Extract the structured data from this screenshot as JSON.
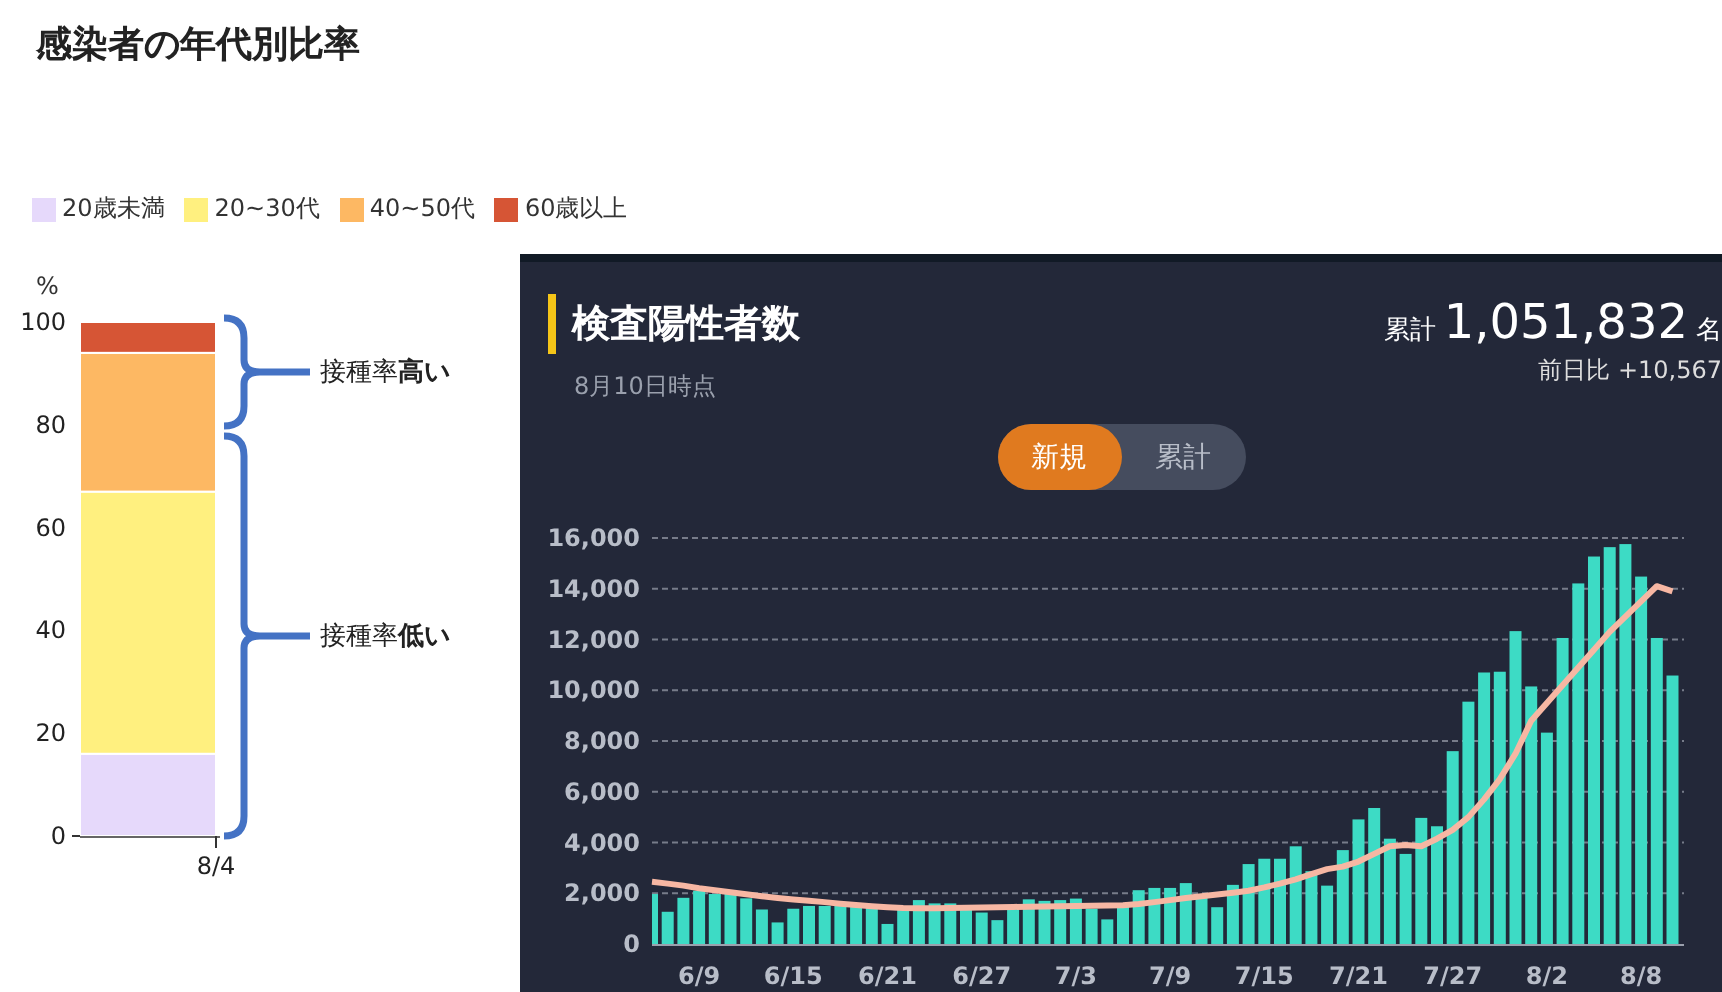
{
  "title": "感染者の年代別比率",
  "age_chart": {
    "chart_data": {
      "type": "bar",
      "stacked": true,
      "ylabel": "%",
      "categories": [
        "8/4"
      ],
      "ylim": [
        0,
        100
      ],
      "yticks": [
        {
          "value": 0,
          "label": "0"
        },
        {
          "value": 20,
          "label": "20"
        },
        {
          "value": 40,
          "label": "40"
        },
        {
          "value": 60,
          "label": "60"
        },
        {
          "value": 80,
          "label": "80"
        },
        {
          "value": 100,
          "label": "100"
        }
      ],
      "series": [
        {
          "name": "20歳未満",
          "color": "#e6d9fb",
          "values": [
            16
          ]
        },
        {
          "name": "20~30代",
          "color": "#fff07f",
          "values": [
            51
          ]
        },
        {
          "name": "40~50代",
          "color": "#fdb863",
          "values": [
            27
          ]
        },
        {
          "name": "60歳以上",
          "color": "#d65535",
          "values": [
            6
          ]
        }
      ],
      "annotations": [
        "接種率**高い**",
        "接種率**低い**"
      ]
    }
  },
  "panel": {
    "title": "検査陽性者数",
    "as_of": "8月10日時点",
    "total_label": "累計",
    "total": "1,051,832",
    "total_unit": "名",
    "change": "前日比 +10,567",
    "toggle": [
      {
        "label": "新規",
        "selected": true
      },
      {
        "label": "累計",
        "selected": false
      }
    ],
    "chart_data": {
      "type": "bar",
      "grid": true,
      "ylim": [
        0,
        16000
      ],
      "yticks": [
        {
          "value": 0,
          "label": "0"
        },
        {
          "value": 2000,
          "label": "2,000"
        },
        {
          "value": 4000,
          "label": "4,000"
        },
        {
          "value": 6000,
          "label": "6,000"
        },
        {
          "value": 8000,
          "label": "8,000"
        },
        {
          "value": 10000,
          "label": "10,000"
        },
        {
          "value": 12000,
          "label": "12,000"
        },
        {
          "value": 14000,
          "label": "14,000"
        },
        {
          "value": 16000,
          "label": "16,000"
        }
      ],
      "categories": [
        null,
        null,
        null,
        "6/9",
        null,
        null,
        null,
        null,
        null,
        "6/15",
        null,
        null,
        null,
        null,
        null,
        "6/21",
        null,
        null,
        null,
        null,
        null,
        "6/27",
        null,
        null,
        null,
        null,
        null,
        "7/3",
        null,
        null,
        null,
        null,
        null,
        "7/9",
        null,
        null,
        null,
        null,
        null,
        "7/15",
        null,
        null,
        null,
        null,
        null,
        "7/21",
        null,
        null,
        null,
        null,
        null,
        "7/27",
        null,
        null,
        null,
        null,
        null,
        "8/2",
        null,
        null,
        null,
        null,
        null,
        "8/8",
        null,
        null
      ],
      "series": [
        {
          "color": "#3ddbc5",
          "values": [
            1970,
            1270,
            1820,
            2100,
            1970,
            1970,
            1800,
            1360,
            850,
            1390,
            1500,
            1500,
            1500,
            1500,
            1420,
            790,
            1360,
            1730,
            1600,
            1600,
            1500,
            1240,
            940,
            1390,
            1760,
            1700,
            1730,
            1790,
            1390,
            970,
            1550,
            2120,
            2210,
            2210,
            2400,
            1850,
            1450,
            2330,
            3150,
            3360,
            3360,
            3850,
            2870,
            2300,
            3700,
            4910,
            5360,
            4150,
            3550,
            4970,
            4640,
            7600,
            9550,
            10700,
            10730,
            12330,
            10150,
            8330,
            12060,
            14210,
            15270,
            15640,
            15760,
            14480,
            12060,
            10580
          ]
        },
        {
          "type": "line",
          "color": "#f7b7a3",
          "values": [
            2450,
            2380,
            2300,
            2200,
            2120,
            2040,
            1960,
            1880,
            1810,
            1750,
            1700,
            1650,
            1590,
            1540,
            1490,
            1450,
            1420,
            1410,
            1410,
            1420,
            1430,
            1440,
            1450,
            1460,
            1470,
            1480,
            1490,
            1500,
            1510,
            1520,
            1530,
            1580,
            1650,
            1730,
            1810,
            1880,
            1950,
            2020,
            2100,
            2230,
            2380,
            2550,
            2750,
            2950,
            3050,
            3250,
            3550,
            3850,
            3900,
            3850,
            4150,
            4500,
            5000,
            5700,
            6500,
            7500,
            8800,
            9500,
            10200,
            10900,
            11600,
            12300,
            12900,
            13500,
            14100,
            13900
          ]
        }
      ]
    }
  }
}
